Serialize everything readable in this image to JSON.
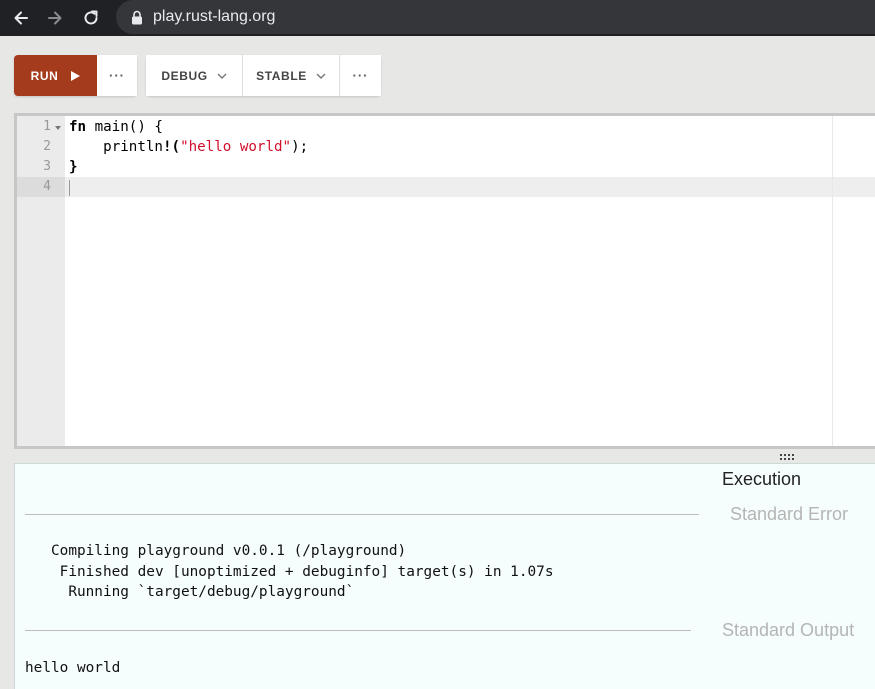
{
  "browser": {
    "url": "play.rust-lang.org",
    "icons": [
      "back-arrow-icon",
      "forward-arrow-icon",
      "reload-icon",
      "lock-icon"
    ]
  },
  "toolbar": {
    "run_label": "RUN",
    "more_label": "···",
    "mode_label": "DEBUG",
    "channel_label": "STABLE",
    "config_more_label": "···"
  },
  "editor": {
    "line_numbers": [
      "1",
      "2",
      "3",
      "4"
    ],
    "lines": [
      [
        "fn",
        " main() {"
      ],
      [
        "    println",
        "!",
        "(",
        "\"hello world\"",
        ");"
      ],
      [
        "}"
      ],
      [
        ""
      ]
    ]
  },
  "output": {
    "title": "Execution",
    "stderr_label": "Standard Error",
    "stderr_lines": [
      "   Compiling playground v0.0.1 (/playground)",
      "    Finished dev [unoptimized + debuginfo] target(s) in 1.07s",
      "     Running `target/debug/playground`"
    ],
    "stdout_label": "Standard Output",
    "stdout_lines": [
      "hello world"
    ]
  }
}
